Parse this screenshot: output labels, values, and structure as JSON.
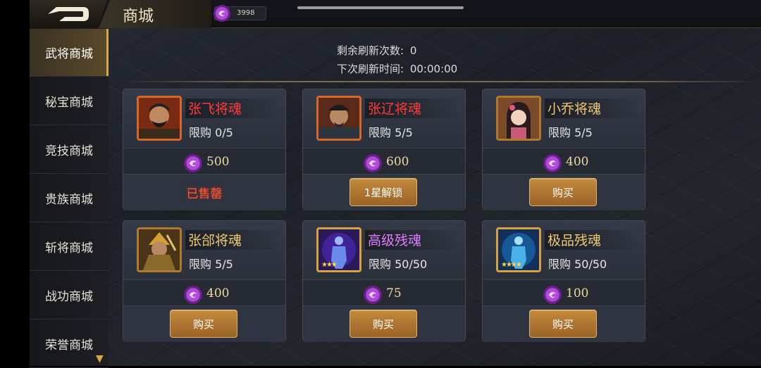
{
  "header": {
    "title": "商城",
    "currency_value": "3998"
  },
  "sidebar": {
    "items": [
      {
        "label": "武将商城"
      },
      {
        "label": "秘宝商城"
      },
      {
        "label": "竞技商城"
      },
      {
        "label": "贵族商城"
      },
      {
        "label": "斩将商城"
      },
      {
        "label": "战功商城"
      },
      {
        "label": "荣誉商城"
      }
    ]
  },
  "refresh": {
    "remaining_label": "剩余刷新次数:",
    "remaining_value": "0",
    "next_label": "下次刷新时间:",
    "next_value": "00:00:00"
  },
  "cards": [
    {
      "name": "张飞将魂",
      "limit": "限购  0/5",
      "price": "500",
      "action": "已售罄",
      "name_color": "#ff3b3b"
    },
    {
      "name": "张辽将魂",
      "limit": "限购  5/5",
      "price": "600",
      "action": "1星解锁",
      "name_color": "#ff3b3b"
    },
    {
      "name": "小乔将魂",
      "limit": "限购  5/5",
      "price": "400",
      "action": "购买",
      "name_color": "#f0c870"
    },
    {
      "name": "张郃将魂",
      "limit": "限购  5/5",
      "price": "400",
      "action": "购买",
      "name_color": "#f0c870"
    },
    {
      "name": "高级残魂",
      "limit": "限购  50/50",
      "price": "75",
      "action": "购买",
      "name_color": "#e07cff"
    },
    {
      "name": "极品残魂",
      "limit": "限购  50/50",
      "price": "100",
      "action": "购买",
      "name_color": "#f0c870"
    }
  ],
  "colors": {
    "accent_gold": "#d7a84a",
    "sold_out": "#ff5a40",
    "gem": "#b04ad8"
  }
}
